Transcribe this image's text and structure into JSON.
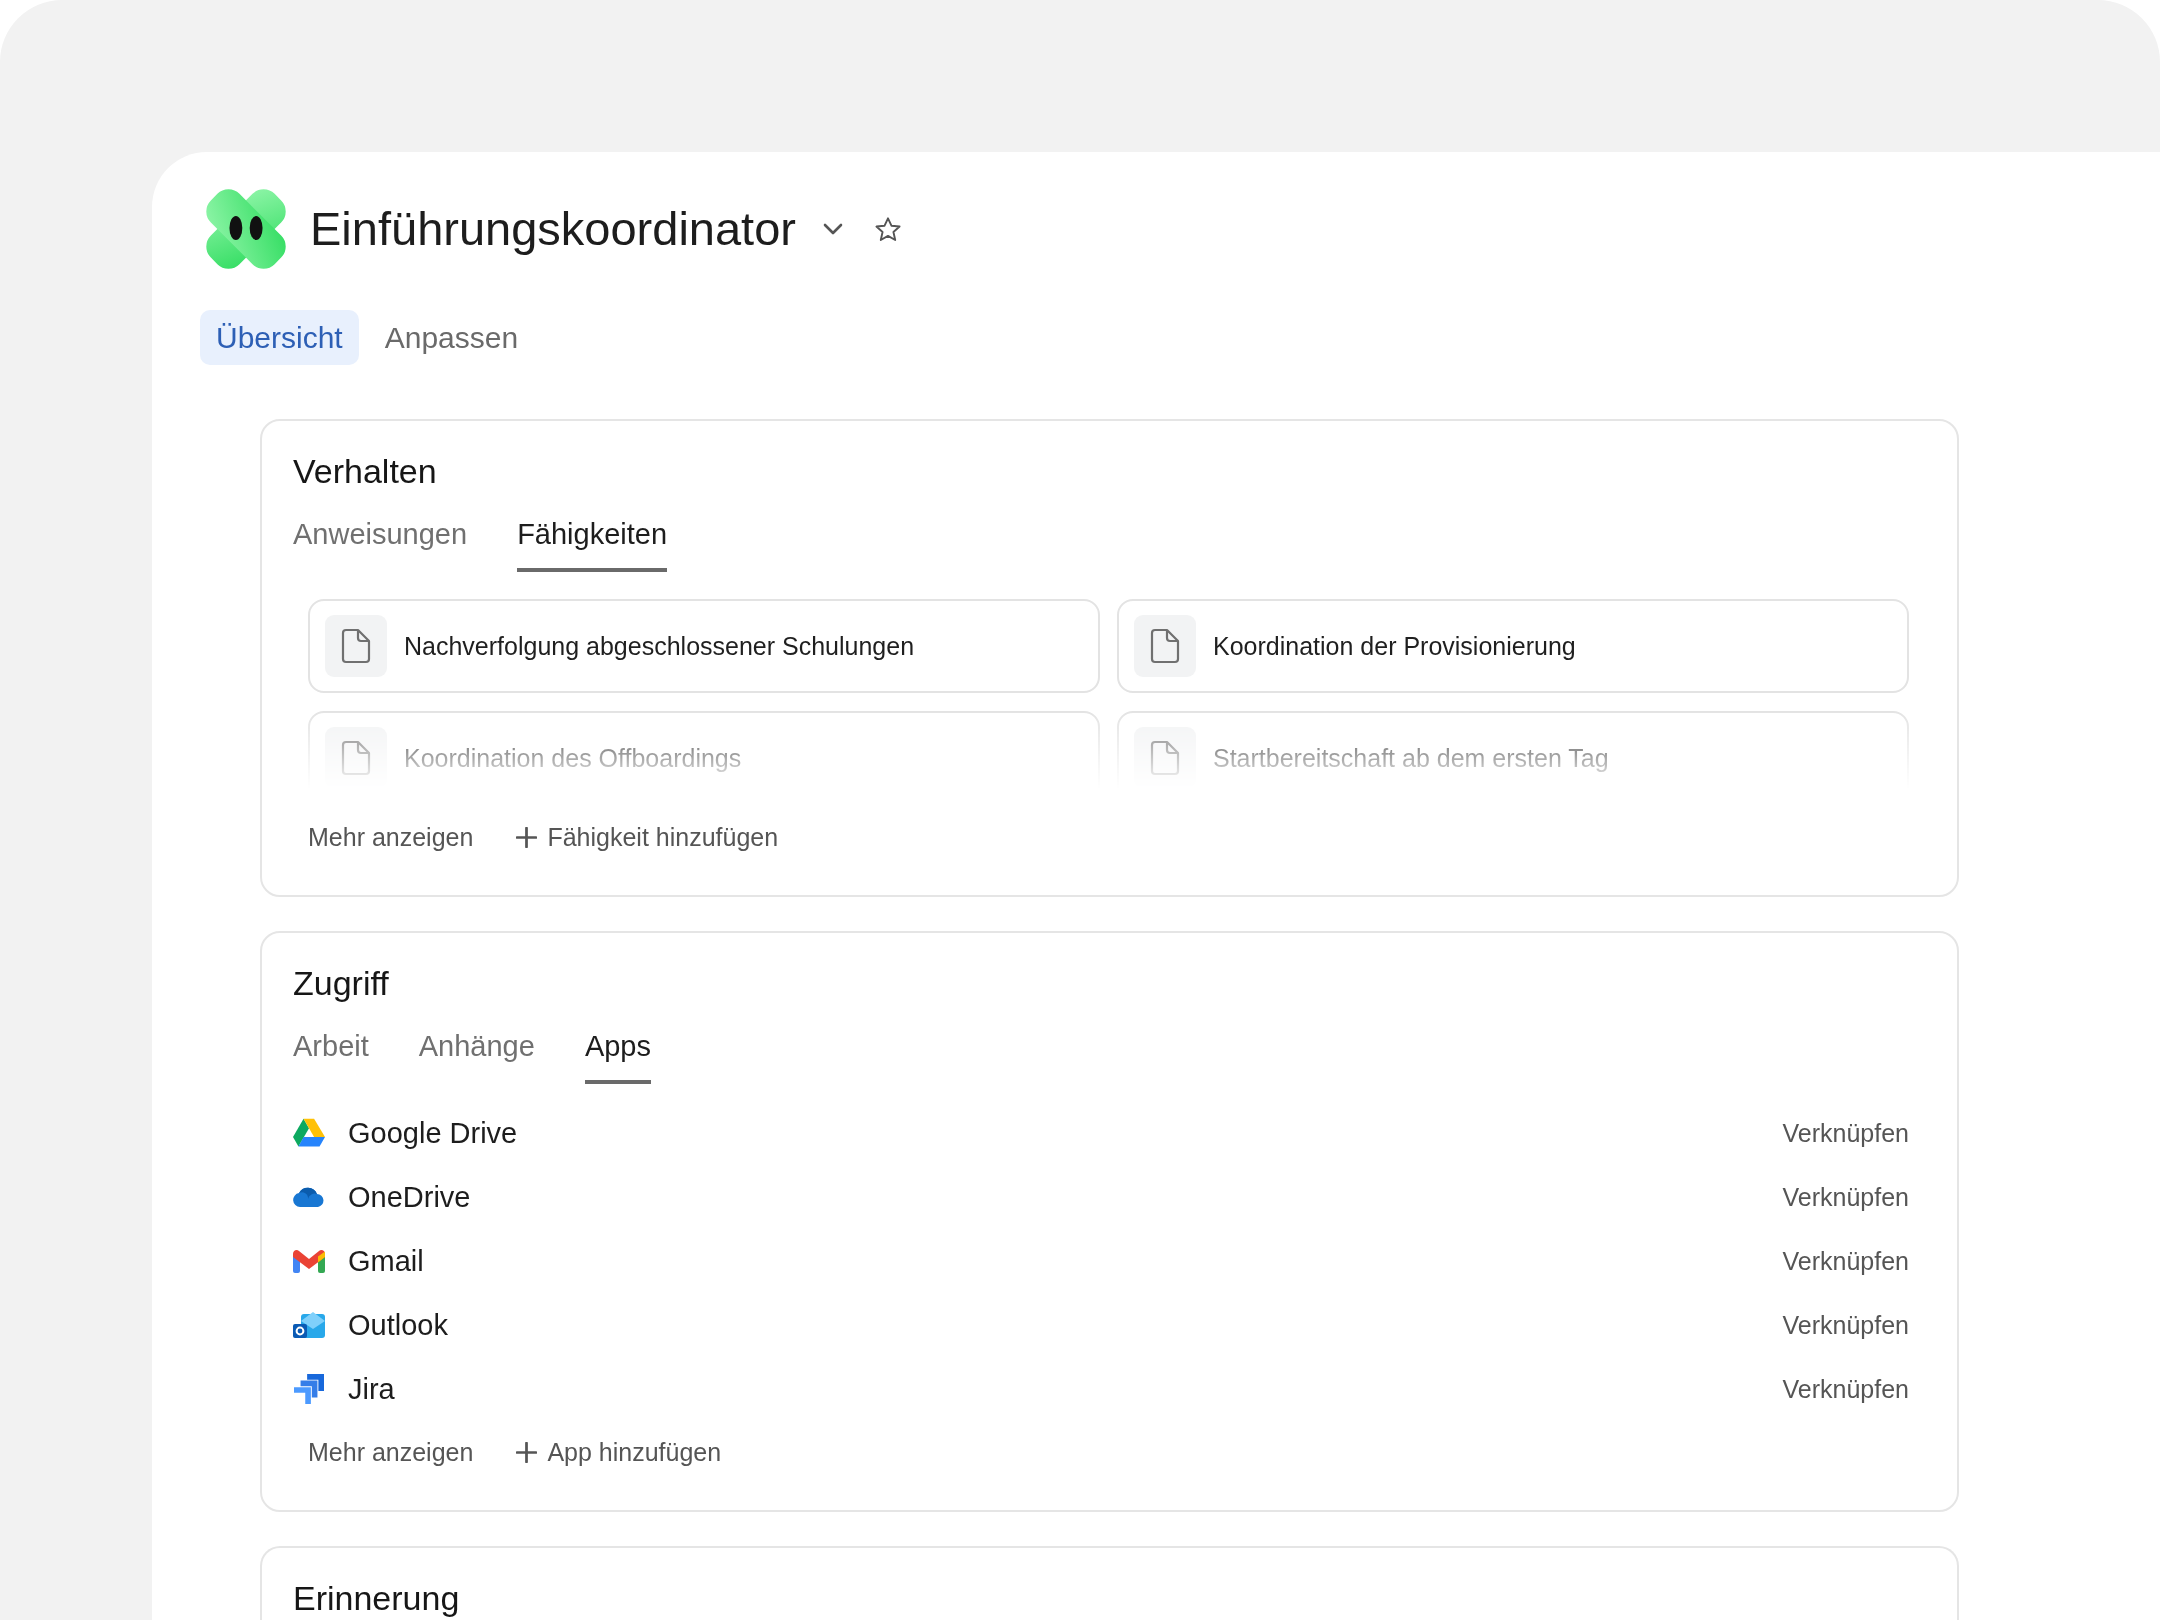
{
  "header": {
    "title": "Einführungskoordinator",
    "starred": false
  },
  "tabs": [
    {
      "label": "Übersicht",
      "selected": true
    },
    {
      "label": "Anpassen",
      "selected": false
    }
  ],
  "sections": [
    {
      "kind": "skills",
      "title": "Verhalten",
      "tabs": [
        {
          "label": "Anweisungen",
          "selected": false
        },
        {
          "label": "Fähigkeiten",
          "selected": true
        }
      ],
      "items": [
        {
          "label": "Nachverfolgung abgeschlossener Schulungen"
        },
        {
          "label": "Koordination der Provisionierung"
        },
        {
          "label": "Koordination des Offboardings"
        },
        {
          "label": "Startbereitschaft ab dem ersten Tag"
        }
      ],
      "more": "Mehr anzeigen",
      "add": "Fähigkeit hinzufügen"
    },
    {
      "kind": "apps",
      "title": "Zugriff",
      "tabs": [
        {
          "label": "Arbeit",
          "selected": false
        },
        {
          "label": "Anhänge",
          "selected": false
        },
        {
          "label": "Apps",
          "selected": true
        }
      ],
      "items": [
        {
          "name": "Google Drive",
          "kind": "triangle",
          "action": "Verknüpfen"
        },
        {
          "name": "OneDrive",
          "kind": "cloud",
          "action": "Verknüpfen"
        },
        {
          "name": "Gmail",
          "kind": "m",
          "action": "Verknüpfen"
        },
        {
          "name": "Outlook",
          "kind": "envelope",
          "action": "Verknüpfen"
        },
        {
          "name": "Jira",
          "kind": "chevrons",
          "action": "Verknüpfen"
        }
      ],
      "more": "Mehr anzeigen",
      "add": "App hinzufügen"
    },
    {
      "kind": "plain",
      "title": "Erinnerung"
    }
  ]
}
